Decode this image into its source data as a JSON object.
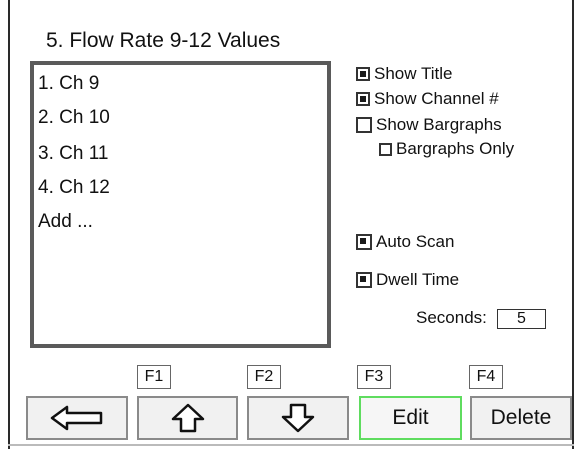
{
  "screen": {
    "title": "5. Flow Rate 9-12 Values"
  },
  "list": {
    "items": [
      "1. Ch 9",
      "2. Ch 10",
      "3. Ch 11",
      "4. Ch 12",
      "Add ..."
    ]
  },
  "options": {
    "show_title": {
      "label": "Show Title",
      "checked": true
    },
    "show_channel": {
      "label": "Show Channel #",
      "checked": true
    },
    "show_bargraphs": {
      "label": "Show Bargraphs",
      "checked": false
    },
    "bargraphs_only": {
      "label": "Bargraphs Only",
      "checked": false
    },
    "auto_scan": {
      "label": "Auto Scan",
      "checked": true
    },
    "dwell_time": {
      "label": "Dwell Time",
      "checked": true
    }
  },
  "dwell": {
    "seconds_label": "Seconds:",
    "seconds_value": "5"
  },
  "function_keys": [
    "F1",
    "F2",
    "F3",
    "F4"
  ],
  "buttons": {
    "back_icon": "left-arrow-icon",
    "up_icon": "up-arrow-icon",
    "down_icon": "down-arrow-icon",
    "edit_label": "Edit",
    "delete_label": "Delete"
  },
  "colors": {
    "active_button_border": "#5fdc5f",
    "list_border": "#5a5a5a"
  }
}
